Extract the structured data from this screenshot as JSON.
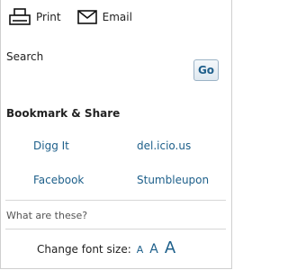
{
  "toolbar": {
    "print_label": "Print",
    "email_label": "Email"
  },
  "search": {
    "label": "Search",
    "value": "",
    "placeholder": "",
    "button_label": "Go"
  },
  "bookmark": {
    "title": "Bookmark & Share",
    "links": [
      {
        "label": "Digg It"
      },
      {
        "label": "del.icio.us"
      },
      {
        "label": "Facebook"
      },
      {
        "label": "Stumbleupon"
      }
    ]
  },
  "help_link": "What are these?",
  "font_size": {
    "label": "Change font size:",
    "options": [
      "A",
      "A",
      "A"
    ]
  },
  "colors": {
    "link": "#1d5f8a",
    "button_text": "#1f5f8b",
    "divider": "#d7d7d7"
  }
}
